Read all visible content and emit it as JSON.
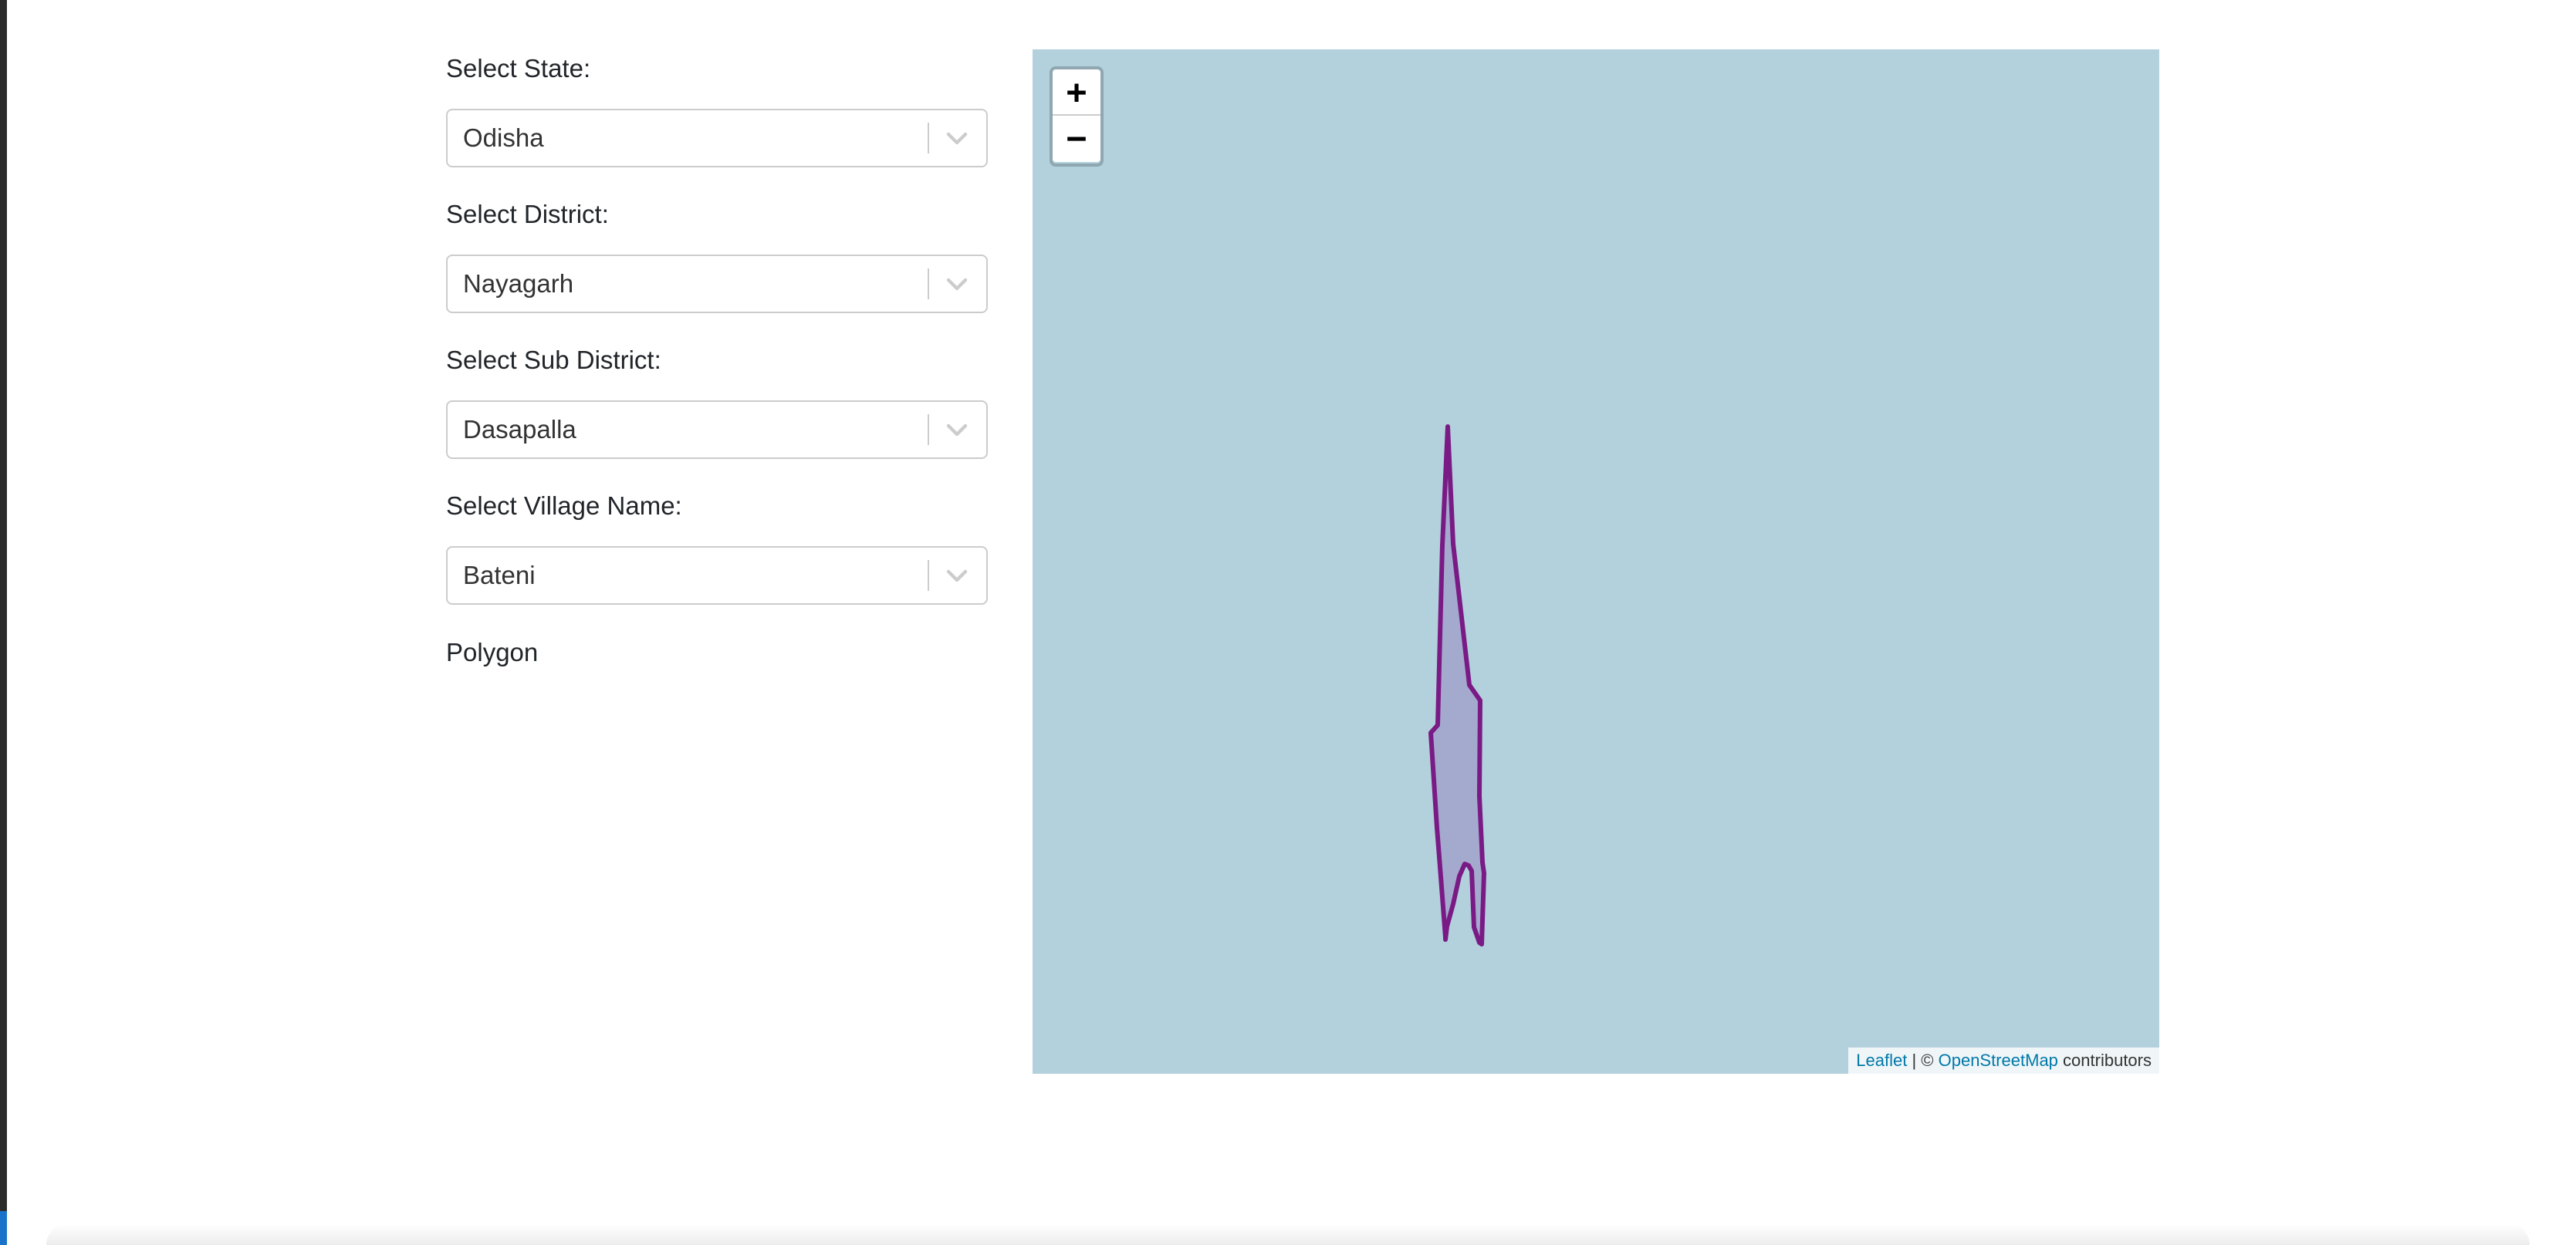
{
  "form": {
    "state": {
      "label": "Select State:",
      "value": "Odisha"
    },
    "district": {
      "label": "Select District:",
      "value": "Nayagarh"
    },
    "sub_district": {
      "label": "Select Sub District:",
      "value": "Dasapalla"
    },
    "village": {
      "label": "Select Village Name:",
      "value": "Bateni"
    },
    "geometry_type": "Polygon"
  },
  "map": {
    "zoom_in_label": "+",
    "zoom_out_label": "−",
    "attribution": {
      "leaflet_link": "Leaflet",
      "separator": "| ©",
      "osm_link": "OpenStreetMap",
      "suffix": "contributors"
    },
    "colors": {
      "background": "#b2d1dc",
      "polygon_stroke": "#7a1a85",
      "polygon_fill": "#9b8fc4"
    }
  },
  "icons": {
    "dropdown": "chevron-down-icon"
  }
}
